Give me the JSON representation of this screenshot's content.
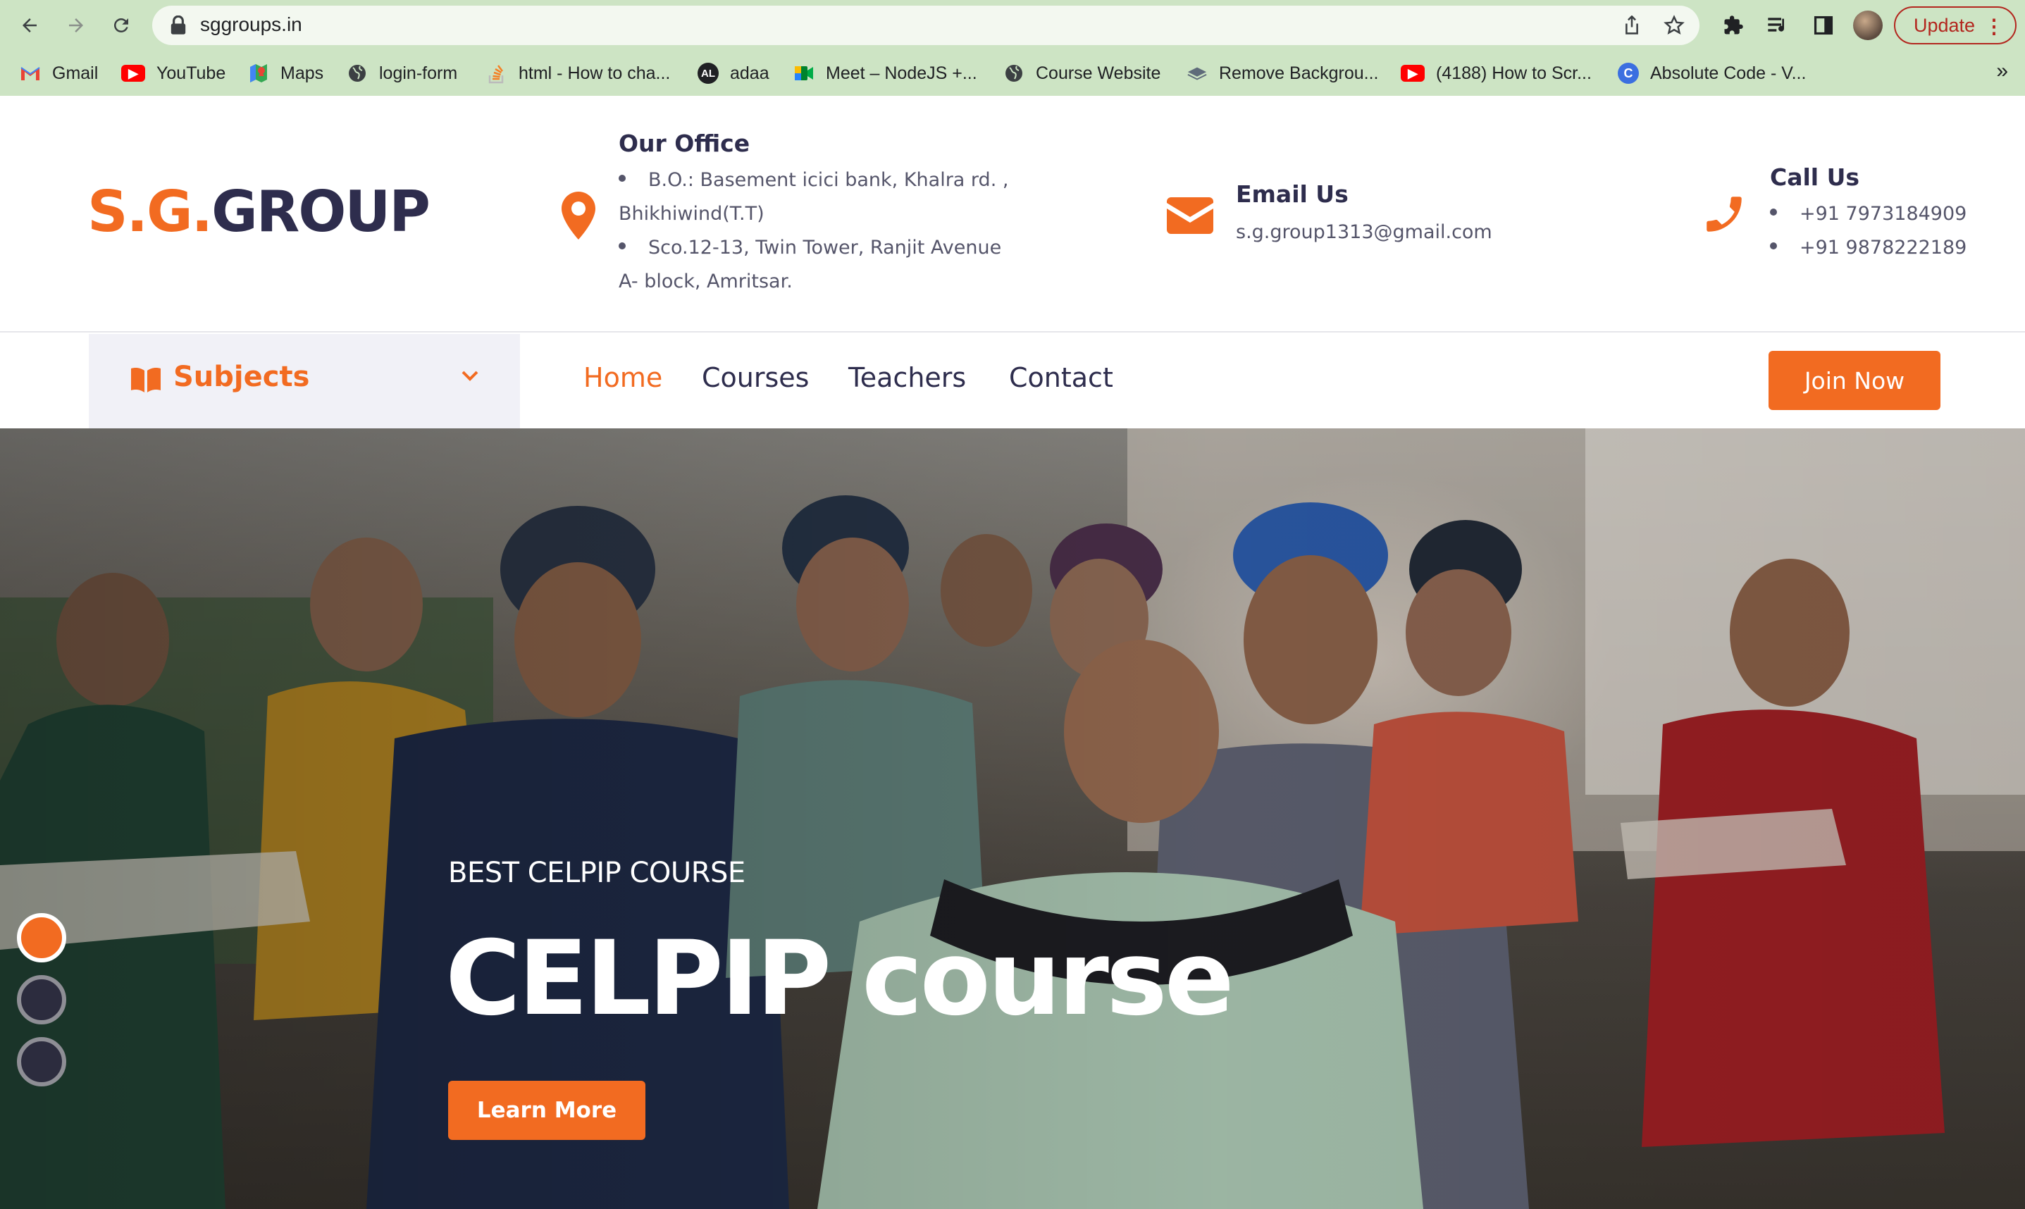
{
  "browser": {
    "url": "sggroups.in",
    "update_label": "Update",
    "bookmarks": [
      {
        "label": "Gmail",
        "icon": "gmail-icon",
        "color": "#ea4335"
      },
      {
        "label": "YouTube",
        "icon": "youtube-icon",
        "color": "#ff0000"
      },
      {
        "label": "Maps",
        "icon": "maps-icon",
        "color": "#34a853"
      },
      {
        "label": "login-form",
        "icon": "globe-icon",
        "color": "#3c4043"
      },
      {
        "label": "html - How to cha...",
        "icon": "stackoverflow-icon",
        "color": "#f48024"
      },
      {
        "label": "adaa",
        "icon": "adaa-icon",
        "color": "#202124"
      },
      {
        "label": "Meet – NodeJS +...",
        "icon": "meet-icon",
        "color": "#00897b"
      },
      {
        "label": "Course Website",
        "icon": "globe-icon",
        "color": "#3c4043"
      },
      {
        "label": "Remove Backgrou...",
        "icon": "removebg-icon",
        "color": "#5f6b7a"
      },
      {
        "label": "(4188) How to Scr...",
        "icon": "youtube-icon",
        "color": "#ff0000"
      },
      {
        "label": "Absolute Code - V...",
        "icon": "absolutecode-icon",
        "color": "#3b6fe0"
      }
    ]
  },
  "header": {
    "logo_part1": "S.G.",
    "logo_part2": "GROUP",
    "office": {
      "title": "Our Office",
      "line1": "B.O.: Basement icici bank, Khalra rd. ,",
      "line2": "Bhikhiwind(T.T)",
      "line3": "Sco.12-13, Twin Tower, Ranjit Avenue",
      "line4": "A- block, Amritsar."
    },
    "email": {
      "title": "Email Us",
      "value": "s.g.group1313@gmail.com"
    },
    "call": {
      "title": "Call Us",
      "phone1": "+91 7973184909",
      "phone2": "+91 9878222189"
    }
  },
  "nav": {
    "subjects_label": "Subjects",
    "links": [
      "Home",
      "Courses",
      "Teachers",
      "Contact"
    ],
    "active": "Home",
    "join_label": "Join Now"
  },
  "hero": {
    "subtitle": "BEST CELPIP COURSE",
    "title": "CELPIP course",
    "button_label": "Learn More",
    "slides": 3,
    "active_slide": 1
  },
  "colors": {
    "accent": "#f26b21",
    "dark": "#2e2d4d",
    "chrome": "#cde4c4"
  }
}
